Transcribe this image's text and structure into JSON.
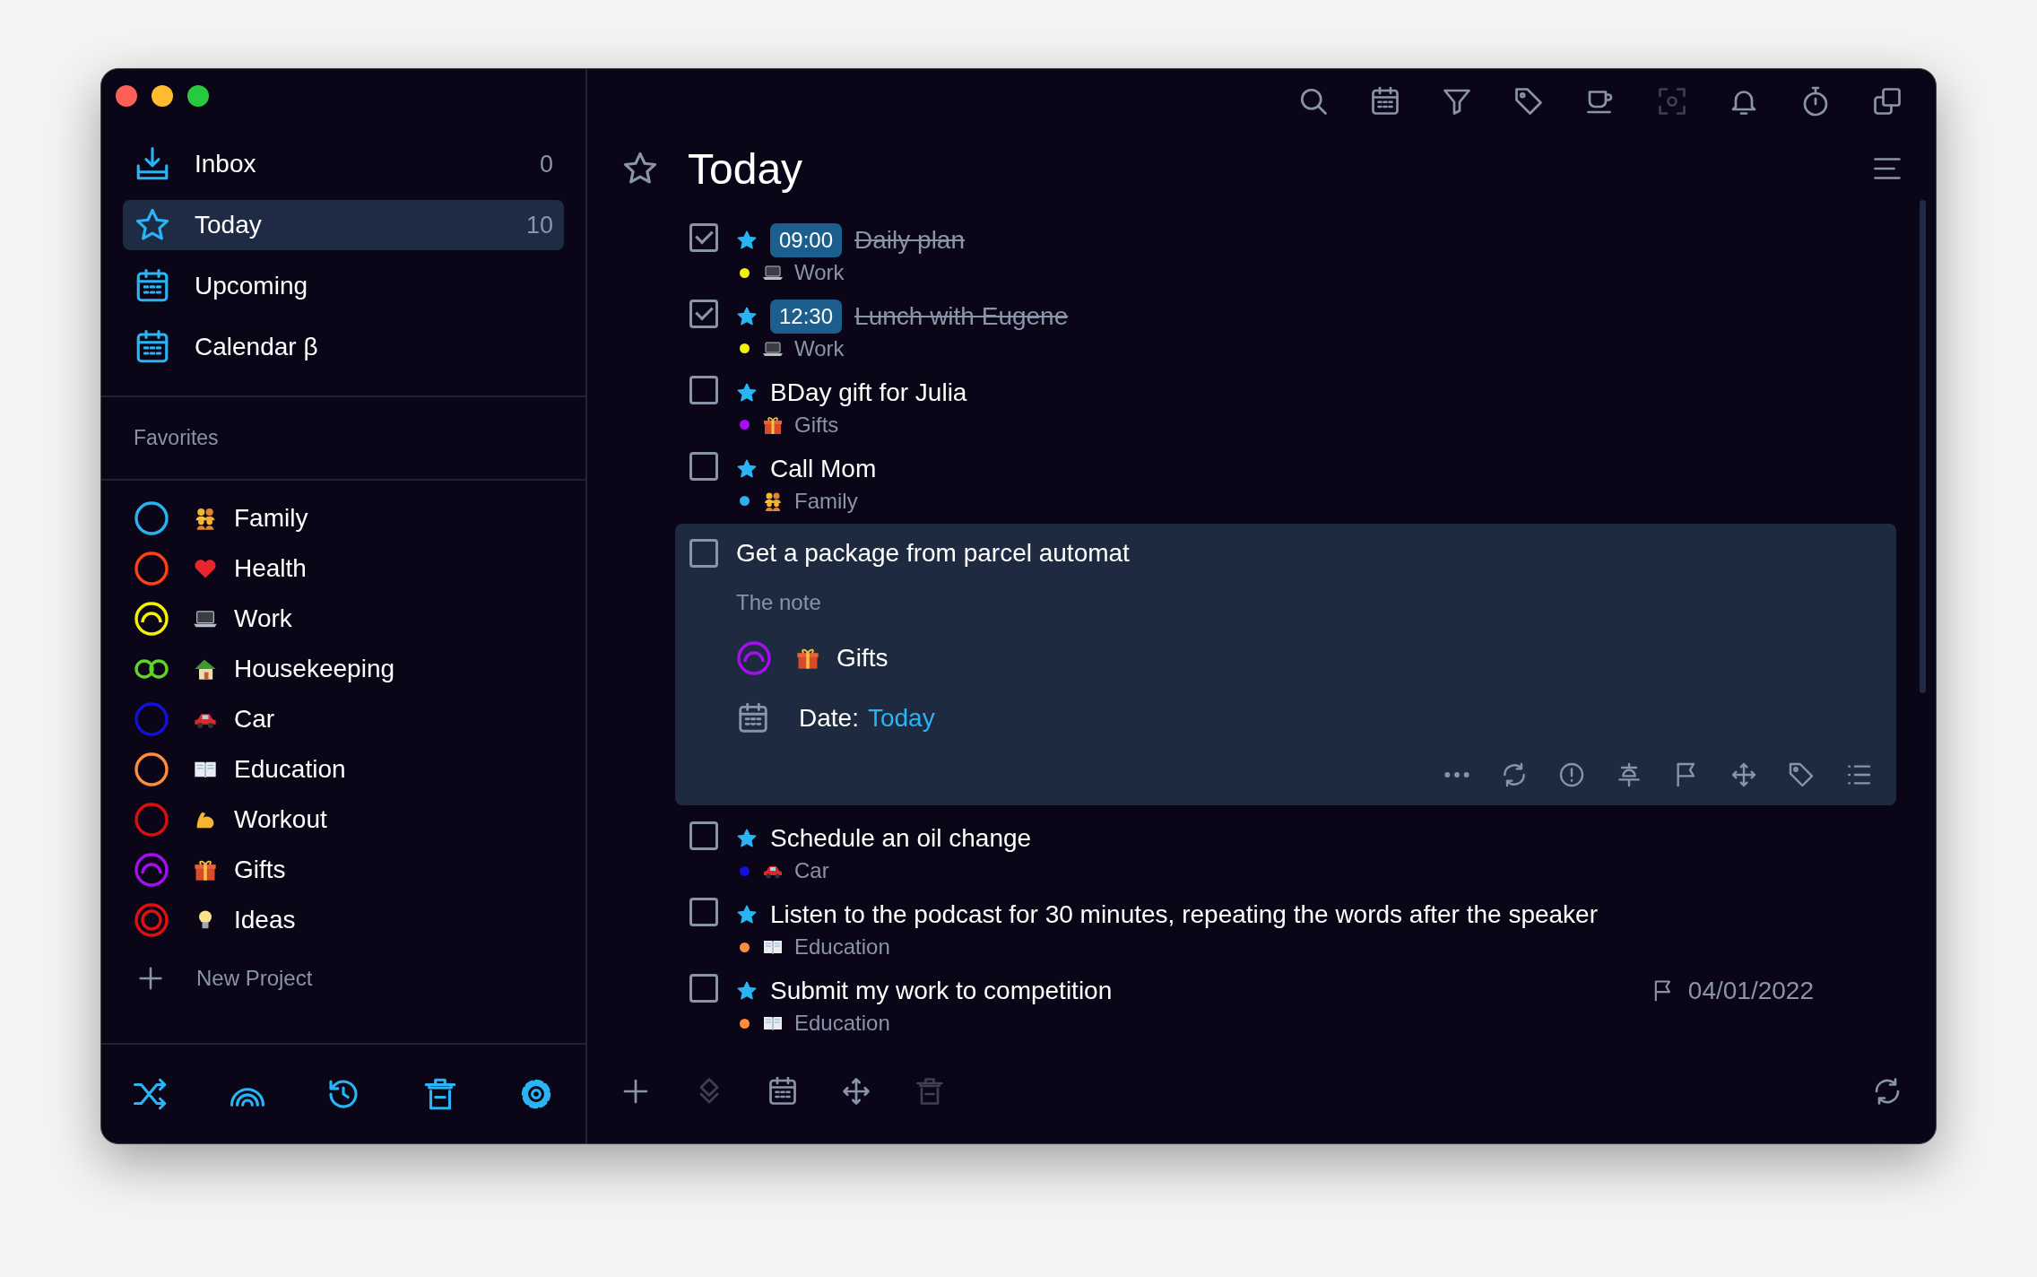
{
  "window": {
    "controls": [
      {
        "color": "#fe5f57"
      },
      {
        "color": "#febc2e"
      },
      {
        "color": "#28c840"
      }
    ]
  },
  "sidebar": {
    "nav": [
      {
        "kind": "inbox",
        "label": "Inbox",
        "count": "0",
        "selected": false
      },
      {
        "kind": "today",
        "label": "Today",
        "count": "10",
        "selected": true
      },
      {
        "kind": "upcoming",
        "label": "Upcoming",
        "selected": false
      },
      {
        "kind": "calendar",
        "label": "Calendar β",
        "selected": false
      }
    ],
    "favorites_heading": "Favorites",
    "projects": [
      {
        "name": "Family",
        "color": "#2bb0f0",
        "kind": "family"
      },
      {
        "name": "Health",
        "color": "#ff4013",
        "kind": "heart"
      },
      {
        "name": "Work",
        "color": "#f5f200",
        "kind": "laptop"
      },
      {
        "name": "Housekeeping",
        "color": "#5ed624",
        "kind": "house"
      },
      {
        "name": "Car",
        "color": "#1410d8",
        "kind": "car"
      },
      {
        "name": "Education",
        "color": "#ff8c3a",
        "kind": "book"
      },
      {
        "name": "Workout",
        "color": "#d90f0f",
        "kind": "arm"
      },
      {
        "name": "Gifts",
        "color": "#a40ef0",
        "kind": "gift"
      },
      {
        "name": "Ideas",
        "color": "#e01010",
        "kind": "bulb"
      }
    ],
    "new_project": "New Project",
    "footer_icons": [
      {
        "kind": "shuffle"
      },
      {
        "kind": "rainbow"
      },
      {
        "kind": "history"
      },
      {
        "kind": "trash"
      },
      {
        "kind": "settings"
      }
    ]
  },
  "main": {
    "toolbar": [
      {
        "kind": "search",
        "disabled": false
      },
      {
        "kind": "calendar",
        "disabled": false
      },
      {
        "kind": "filter",
        "disabled": false
      },
      {
        "kind": "tag",
        "disabled": false
      },
      {
        "kind": "cup",
        "disabled": false
      },
      {
        "kind": "focus",
        "disabled": true
      },
      {
        "kind": "bell",
        "disabled": false
      },
      {
        "kind": "timer",
        "disabled": false
      },
      {
        "kind": "copy",
        "disabled": false
      }
    ],
    "title": "Today",
    "tasks": [
      {
        "title": "Daily plan",
        "done": true,
        "starred": true,
        "expanded": false,
        "time": "09:00",
        "project": {
          "name": "Work",
          "color": "#f5f200",
          "kind": "laptop"
        }
      },
      {
        "title": "Lunch with Eugene",
        "done": true,
        "starred": true,
        "expanded": false,
        "time": "12:30",
        "project": {
          "name": "Work",
          "color": "#f5f200",
          "kind": "laptop"
        }
      },
      {
        "title": "BDay gift for Julia",
        "done": false,
        "starred": true,
        "expanded": false,
        "project": {
          "name": "Gifts",
          "color": "#a40ef0",
          "kind": "gift"
        }
      },
      {
        "title": "Call Mom",
        "done": false,
        "starred": true,
        "expanded": false,
        "project": {
          "name": "Family",
          "color": "#2bb0f0",
          "kind": "family"
        }
      },
      {
        "title": "Get a package from parcel automat",
        "done": false,
        "starred": false,
        "expanded": true,
        "note": "The note",
        "project": {
          "name": "Gifts",
          "color": "#a40ef0",
          "kind": "gift"
        },
        "date_label": "Date:",
        "date_value": "Today",
        "actions": [
          {
            "kind": "more"
          },
          {
            "kind": "repeat"
          },
          {
            "kind": "alert"
          },
          {
            "kind": "pin"
          },
          {
            "kind": "flag"
          },
          {
            "kind": "move"
          },
          {
            "kind": "tag"
          },
          {
            "kind": "checklist"
          }
        ]
      },
      {
        "title": "Schedule an oil change",
        "done": false,
        "starred": true,
        "expanded": false,
        "project": {
          "name": "Car",
          "color": "#1410d8",
          "kind": "car"
        }
      },
      {
        "title": "Listen to the podcast for 30 minutes, repeating the words after the speaker",
        "done": false,
        "starred": true,
        "expanded": false,
        "project": {
          "name": "Education",
          "color": "#ff8c3a",
          "kind": "book"
        }
      },
      {
        "title": "Submit my work to competition",
        "done": false,
        "starred": true,
        "expanded": false,
        "due": "04/01/2022",
        "project": {
          "name": "Education",
          "color": "#ff8c3a",
          "kind": "book"
        }
      }
    ],
    "footer_icons": [
      {
        "kind": "plus",
        "disabled": false
      },
      {
        "kind": "layers",
        "disabled": true
      },
      {
        "kind": "calendar",
        "disabled": false
      },
      {
        "kind": "move",
        "disabled": false
      },
      {
        "kind": "trash",
        "disabled": true
      }
    ],
    "sync_icon": {
      "kind": "sync",
      "disabled": false
    }
  }
}
